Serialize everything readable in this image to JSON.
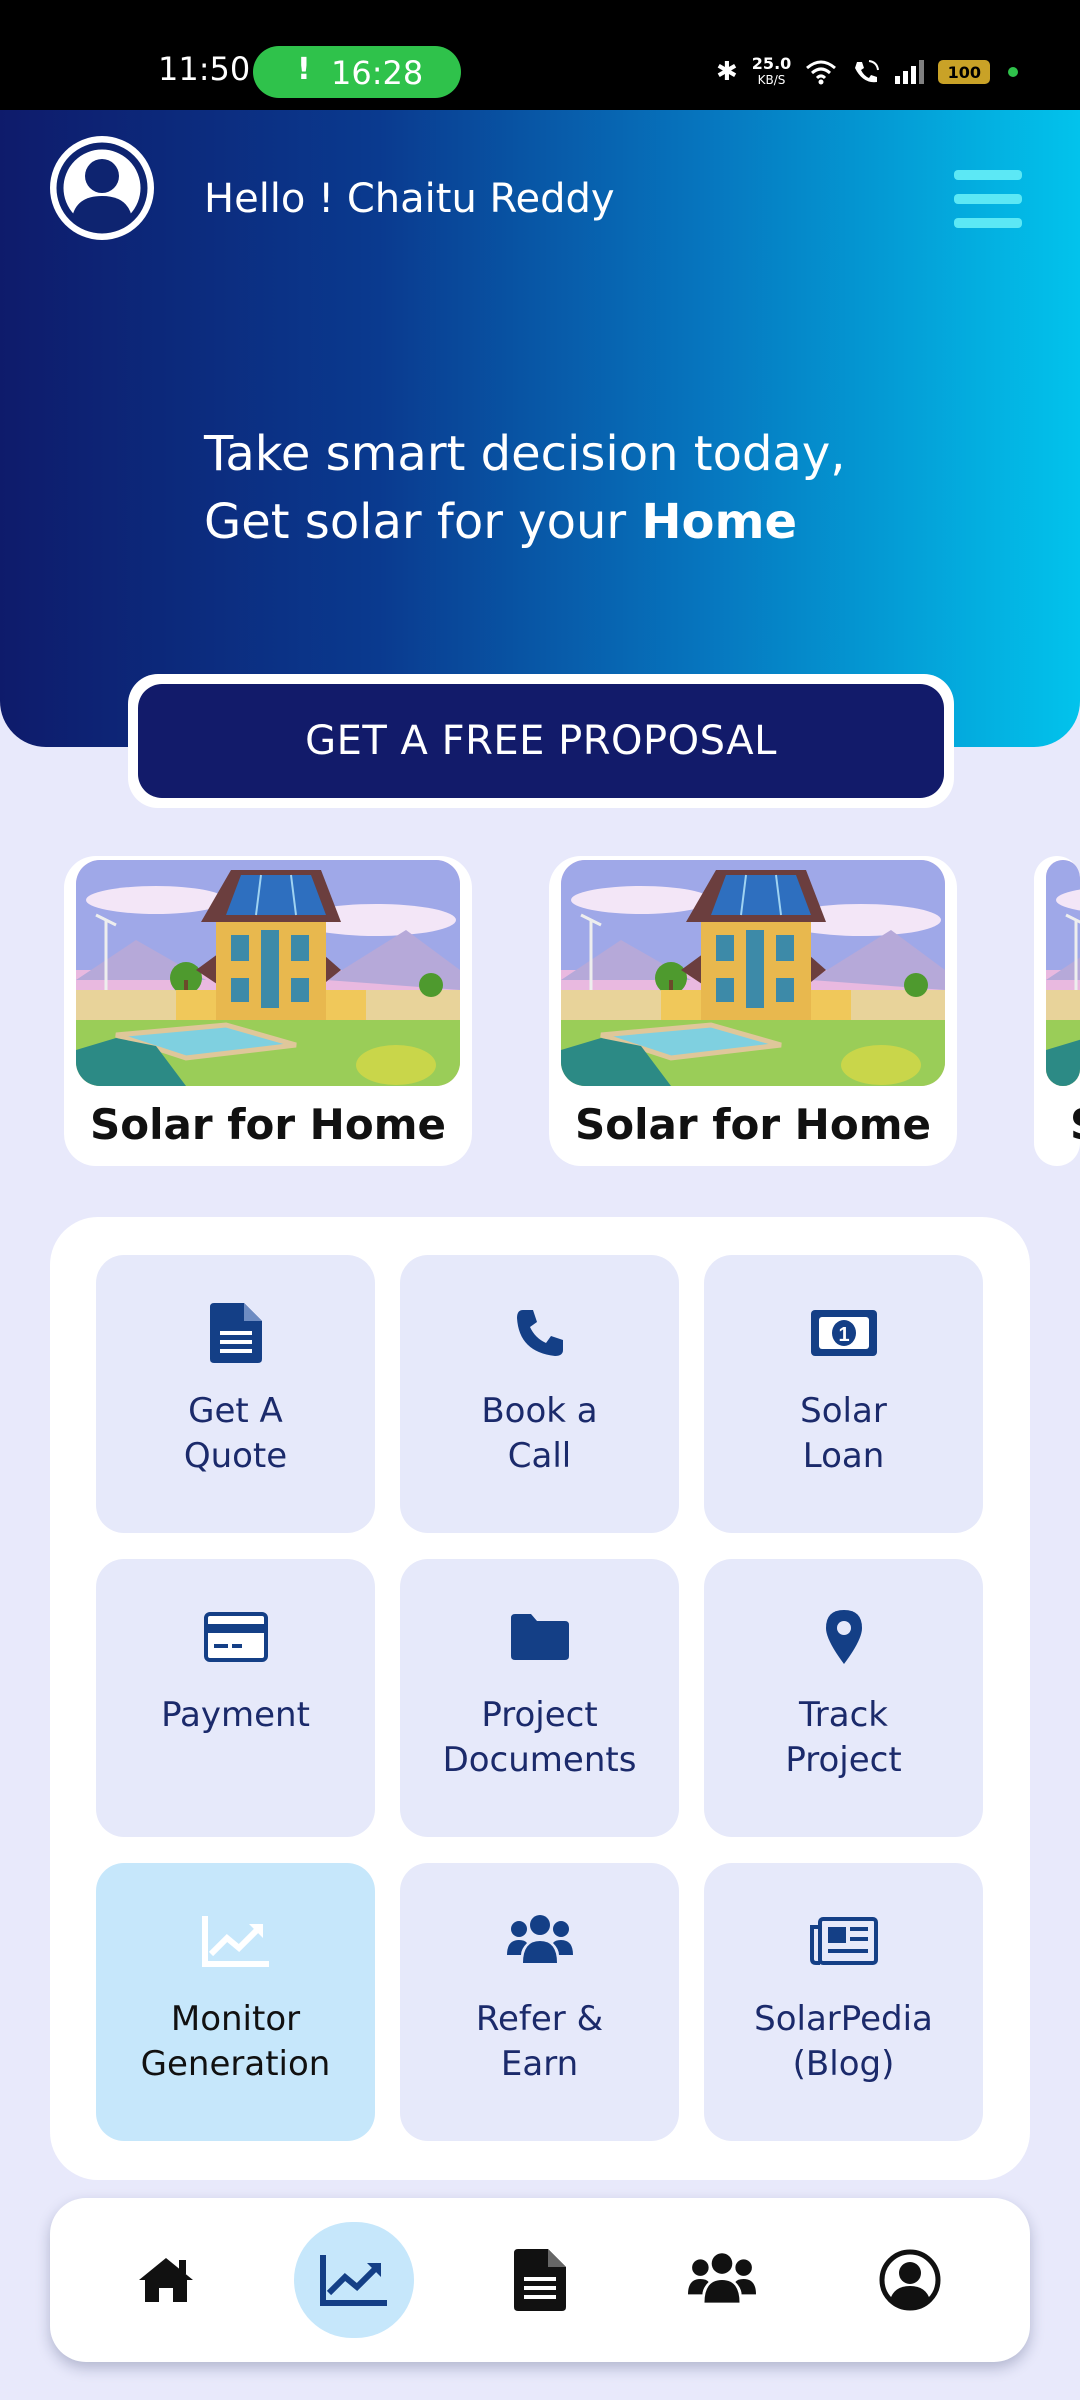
{
  "status_bar": {
    "time": "11:50",
    "call_pill_time": "16:28",
    "call_pill_icon": "exclamation-icon",
    "net_speed": "25.0",
    "net_speed_unit": "KB/S",
    "battery": "100"
  },
  "header": {
    "greeting": "Hello ! Chaitu Reddy",
    "tagline_line1": "Take smart decision today,",
    "tagline_line2_prefix": "Get solar for your ",
    "tagline_line2_bold": "Home",
    "cta_label": "GET A FREE PROPOSAL"
  },
  "carousel": [
    {
      "title": "Solar for Home"
    },
    {
      "title": "Solar for Home"
    },
    {
      "title": "S"
    }
  ],
  "services": [
    {
      "line1": "Get A",
      "line2": "Quote",
      "icon": "document-icon"
    },
    {
      "line1": "Book a",
      "line2": "Call",
      "icon": "phone-icon"
    },
    {
      "line1": "Solar",
      "line2": "Loan",
      "icon": "money-icon"
    },
    {
      "line1": "Payment",
      "line2": "",
      "icon": "credit-card-icon"
    },
    {
      "line1": "Project",
      "line2": "Documents",
      "icon": "folder-icon"
    },
    {
      "line1": "Track",
      "line2": "Project",
      "icon": "location-pin-icon"
    },
    {
      "line1": "Monitor",
      "line2": "Generation",
      "icon": "chart-line-icon"
    },
    {
      "line1": "Refer &",
      "line2": "Earn",
      "icon": "users-icon"
    },
    {
      "line1": "SolarPedia",
      "line2": "(Blog)",
      "icon": "newspaper-icon"
    }
  ],
  "bottom_nav": [
    {
      "icon": "home-icon"
    },
    {
      "icon": "chart-line-icon",
      "active": true
    },
    {
      "icon": "document-icon"
    },
    {
      "icon": "users-icon"
    },
    {
      "icon": "profile-icon"
    }
  ],
  "colors": {
    "navy": "#121B6A",
    "icon_blue": "#143F86",
    "cyan": "#02C3EC",
    "tile_bg": "#E6E9FA",
    "active_bg": "#C6E7FB",
    "page_bg": "#E8E9FB"
  }
}
